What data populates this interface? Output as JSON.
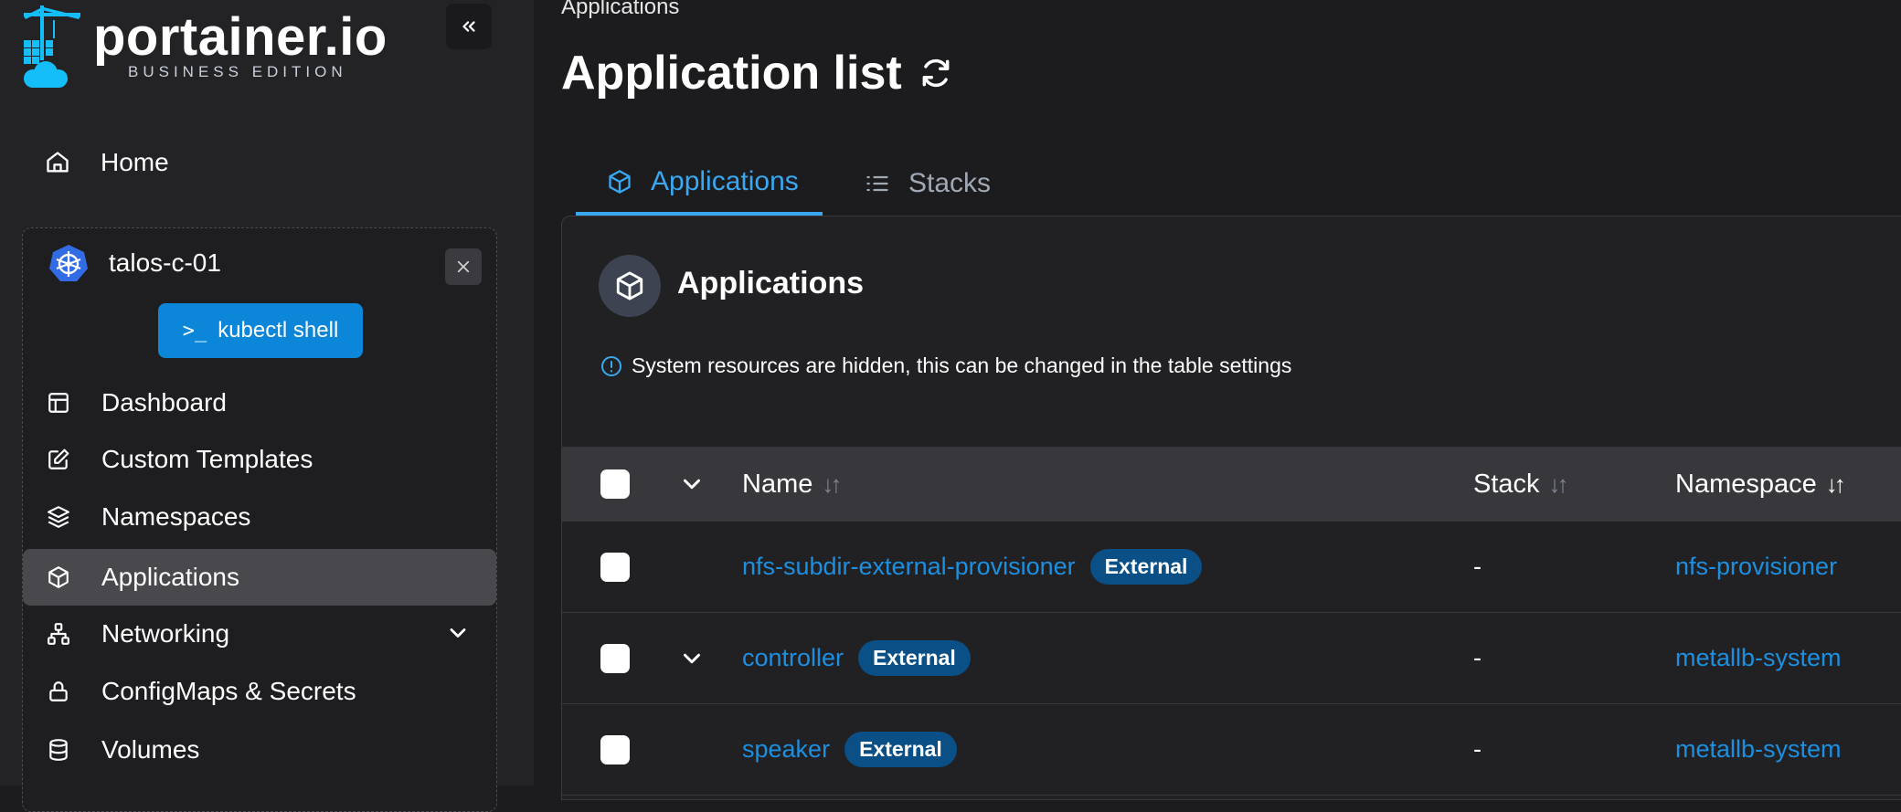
{
  "brand": {
    "name": "portainer.io",
    "edition": "BUSINESS EDITION"
  },
  "sidebar": {
    "collapse_icon": "chevrons-left-icon",
    "home_label": "Home",
    "environment": {
      "name": "talos-c-01",
      "kubectl_label": "kubectl shell",
      "items": [
        {
          "label": "Dashboard",
          "icon": "layout-icon",
          "active": false
        },
        {
          "label": "Custom Templates",
          "icon": "edit-icon",
          "active": false
        },
        {
          "label": "Namespaces",
          "icon": "layers-icon",
          "active": false
        },
        {
          "label": "Applications",
          "icon": "box-icon",
          "active": true
        },
        {
          "label": "Networking",
          "icon": "network-icon",
          "active": false,
          "expandable": true
        },
        {
          "label": "ConfigMaps & Secrets",
          "icon": "lock-icon",
          "active": false
        },
        {
          "label": "Volumes",
          "icon": "database-icon",
          "active": false
        }
      ]
    }
  },
  "main": {
    "breadcrumb": "Applications",
    "title": "Application list",
    "tabs": [
      {
        "label": "Applications",
        "active": true
      },
      {
        "label": "Stacks",
        "active": false
      }
    ],
    "panel": {
      "title": "Applications",
      "notice": "System resources are hidden, this can be changed in the table settings"
    },
    "table": {
      "columns": [
        "Name",
        "Stack",
        "Namespace"
      ],
      "rows": [
        {
          "name": "nfs-subdir-external-provisioner",
          "badge": "External",
          "stack": "-",
          "namespace": "nfs-provisioner",
          "expandable": false
        },
        {
          "name": "controller",
          "badge": "External",
          "stack": "-",
          "namespace": "metallb-system",
          "expandable": true
        },
        {
          "name": "speaker",
          "badge": "External",
          "stack": "-",
          "namespace": "metallb-system",
          "expandable": false
        }
      ]
    }
  },
  "colors": {
    "accent": "#39a8f0",
    "link": "#1d8fe0",
    "primary_button": "#0b86d9",
    "badge": "#0a4f86"
  }
}
